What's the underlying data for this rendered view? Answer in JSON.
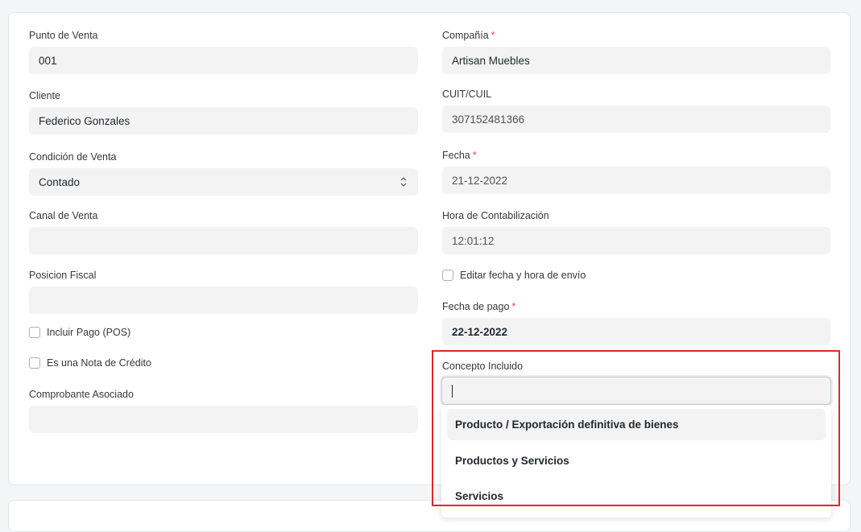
{
  "left": {
    "punto_de_venta": {
      "label": "Punto de Venta",
      "value": "001"
    },
    "cliente": {
      "label": "Cliente",
      "value": "Federico Gonzales"
    },
    "condicion_de_venta": {
      "label": "Condición de Venta",
      "value": "Contado"
    },
    "canal_de_venta": {
      "label": "Canal de Venta",
      "value": ""
    },
    "posicion_fiscal": {
      "label": "Posicion Fiscal",
      "value": ""
    },
    "incluir_pago": {
      "label": "Incluir Pago (POS)",
      "checked": false
    },
    "nota_de_credito": {
      "label": "Es una Nota de Crédito",
      "checked": false
    },
    "comprobante_asociado": {
      "label": "Comprobante Asociado",
      "value": ""
    }
  },
  "right": {
    "compania": {
      "label": "Compañía",
      "required": "*",
      "value": "Artisan Muebles"
    },
    "cuit": {
      "label": "CUIT/CUIL",
      "value": "307152481366"
    },
    "fecha": {
      "label": "Fecha",
      "required": "*",
      "value": "21-12-2022"
    },
    "hora": {
      "label": "Hora de Contabilización",
      "value": "12:01:12"
    },
    "editar_fecha": {
      "label": "Editar fecha y hora de envío",
      "checked": false
    },
    "fecha_de_pago": {
      "label": "Fecha de pago",
      "required": "*",
      "value": "22-12-2022"
    },
    "concepto_incluido": {
      "label": "Concepto Incluido",
      "value": "",
      "options": [
        "Producto / Exportación definitiva de bienes",
        "Productos y Servicios",
        "Servicios"
      ]
    }
  },
  "colors": {
    "required": "#e24c4c",
    "highlight_border": "#e3262b",
    "field_bg": "#f3f3f3"
  },
  "icons": {
    "select_arrow": "chevron-up-down-icon"
  }
}
